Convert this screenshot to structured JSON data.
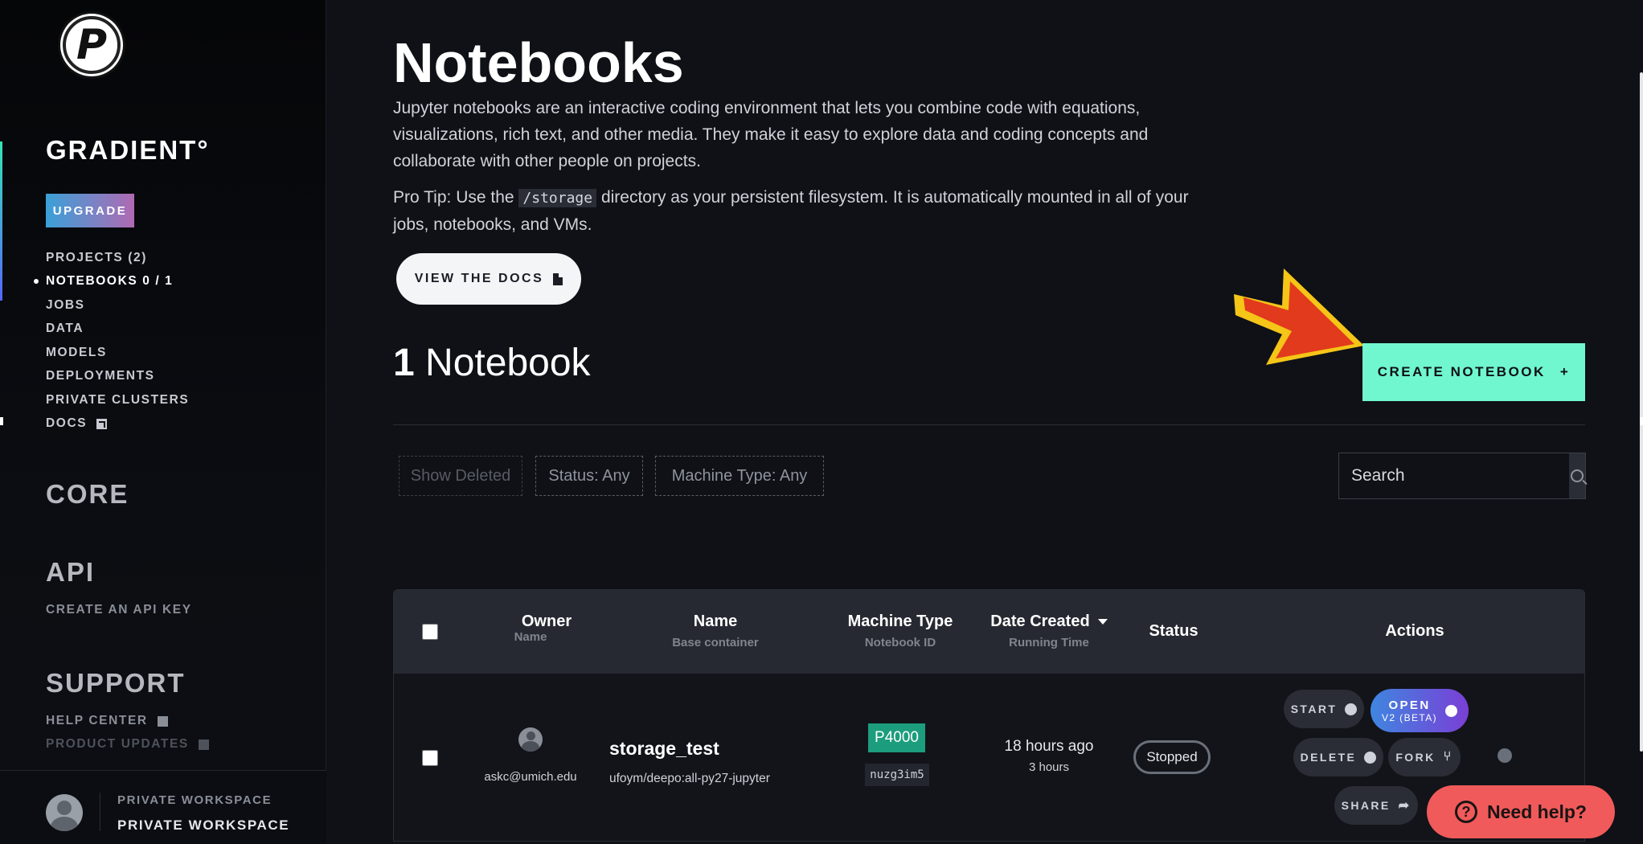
{
  "sidebar": {
    "logo_letter": "P",
    "brand": "GRADIENT°",
    "upgrade_label": "UPGRADE",
    "nav": [
      {
        "label": "PROJECTS  (2)"
      },
      {
        "label": "NOTEBOOKS 0 / 1"
      },
      {
        "label": "JOBS"
      },
      {
        "label": "DATA"
      },
      {
        "label": "MODELS"
      },
      {
        "label": "DEPLOYMENTS"
      },
      {
        "label": "PRIVATE CLUSTERS"
      },
      {
        "label": "DOCS"
      }
    ],
    "core_title": "CORE",
    "api_title": "API",
    "api_link": "CREATE AN API KEY",
    "support_title": "SUPPORT",
    "help_center": "HELP CENTER",
    "product_updates": "PRODUCT UPDATES",
    "workspace_label": "PRIVATE WORKSPACE",
    "workspace_name": "PRIVATE WORKSPACE"
  },
  "main": {
    "title": "Notebooks",
    "description": "Jupyter notebooks are an interactive coding environment that lets you combine code with equations, visualizations, rich text, and other media. They make it easy to explore data and coding concepts and collaborate with other people on projects.",
    "protip_prefix": "Pro Tip: Use the ",
    "protip_code": "/storage",
    "protip_suffix": " directory as your persistent filesystem. It is automatically mounted in all of your jobs, notebooks, and VMs.",
    "docs_button": "VIEW THE DOCS",
    "count_number": "1",
    "count_label": "Notebook",
    "create_button": "CREATE NOTEBOOK",
    "create_plus": "+",
    "filters": {
      "show_deleted": "Show Deleted",
      "status": "Status: Any",
      "machine_type": "Machine Type: Any"
    },
    "search_placeholder": "Search"
  },
  "table": {
    "headers": {
      "owner": "Owner",
      "owner_sub": "Name",
      "name": "Name",
      "name_sub": "Base container",
      "machine": "Machine Type",
      "machine_sub": "Notebook ID",
      "date": "Date Created",
      "date_sub": "Running Time",
      "status": "Status",
      "actions": "Actions"
    },
    "rows": [
      {
        "owner_email": "askc@umich.edu",
        "name": "storage_test",
        "container": "ufoym/deepo:all-py27-jupyter",
        "machine_type": "P4000",
        "notebook_id": "nuzg3im5",
        "date_created": "18 hours ago",
        "running_time": "3 hours",
        "status": "Stopped",
        "actions": {
          "start": "START",
          "open": "OPEN",
          "open_sub": "V2 (BETA)",
          "delete": "DELETE",
          "fork": "FORK",
          "share": "SHARE"
        }
      }
    ]
  },
  "help_button": "Need help?",
  "help_icon": "?",
  "colors": {
    "accent_green": "#70f7cf",
    "machine_badge": "#1c9d7d",
    "help_red": "#f15a5a",
    "annotation_arrow": "#e23a1c",
    "annotation_border": "#f5c518"
  }
}
